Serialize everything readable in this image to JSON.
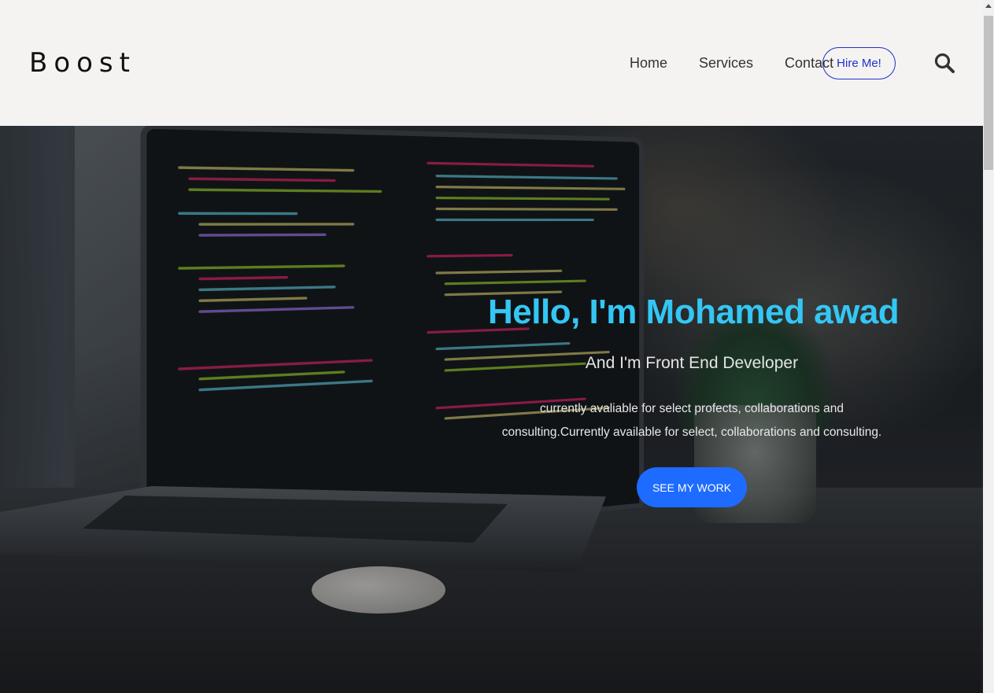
{
  "header": {
    "logo": "Boost",
    "nav": [
      {
        "label": "Home"
      },
      {
        "label": "Services"
      },
      {
        "label": "Contact"
      }
    ],
    "hire_label": "Hire Me!",
    "search_icon": "search-icon"
  },
  "hero": {
    "title": "Hello, I'm Mohamed awad",
    "subtitle": "And I'm Front End Developer",
    "description": "currently avaliable for select profects, collaborations and consulting.Currently available for select, collaborations and consulting.",
    "cta_label": "SEE MY WORK",
    "colors": {
      "title": "#34c6f4",
      "cta": "#1e6bff",
      "hire_border": "#1f2fcc"
    }
  }
}
